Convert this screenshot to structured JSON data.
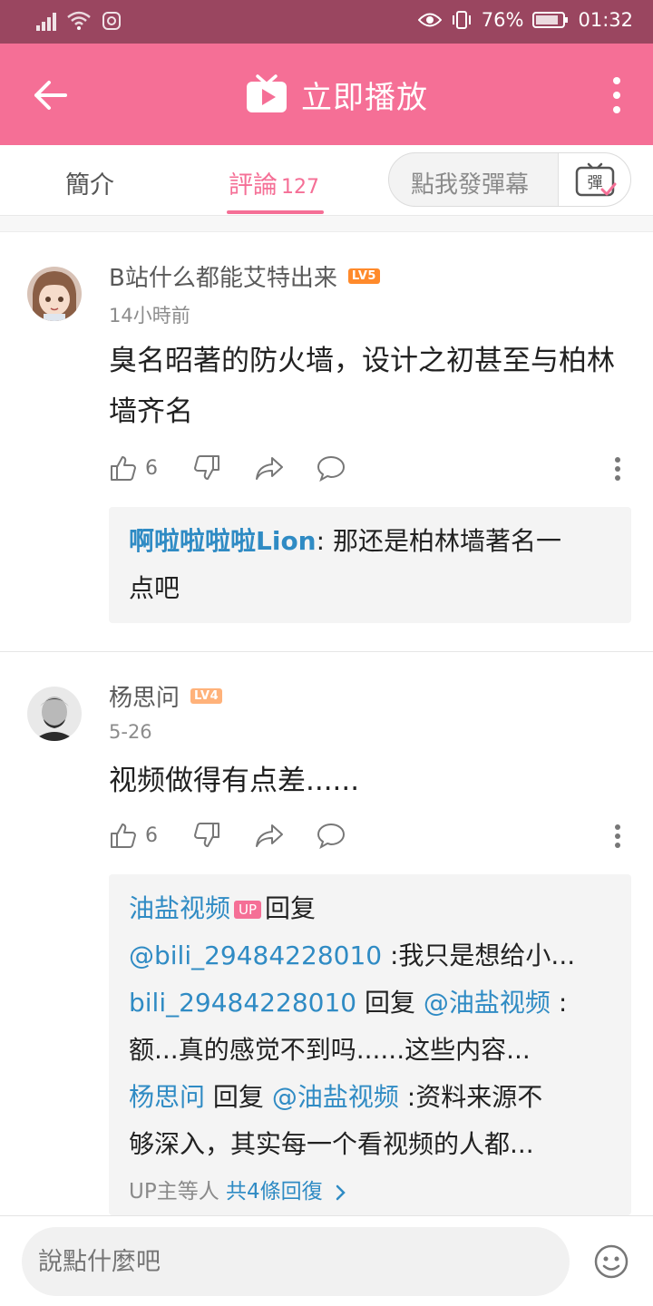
{
  "status_bar": {
    "battery": "76%",
    "time": "01:32"
  },
  "app_bar": {
    "play_label": "立即播放"
  },
  "tabs": {
    "intro": "簡介",
    "comments": "評論",
    "comments_count": "127",
    "danmaku_placeholder": "點我發彈幕",
    "danmaku_icon_text": "彈"
  },
  "comments": [
    {
      "user": "B站什么都能艾特出来",
      "level": "LV5",
      "time": "14小時前",
      "text": "臭名昭著的防火墙，设计之初甚至与柏林墙齐名",
      "likes": "6",
      "replies": [
        {
          "user": "啊啦啦啦啦Lion",
          "text": ": 那还是柏林墙著名一点吧"
        }
      ]
    },
    {
      "user": "杨思问",
      "level": "LV4",
      "time": "5-26",
      "text": "视频做得有点差......",
      "likes": "6",
      "replies": [
        {
          "user": "油盐视频",
          "badge": "UP",
          "reply_word": "回复"
        },
        {
          "mention": "@bili_29484228010",
          "text": " :我只是想给小..."
        },
        {
          "user": "bili_29484228010",
          "reply_word": "回复",
          "mention": "@油盐视频",
          "text": " :"
        },
        {
          "text": "额...真的感觉不到吗......这些内容..."
        },
        {
          "user": "杨思问",
          "reply_word": "回复",
          "mention": "@油盐视频",
          "text": " :资料来源不"
        },
        {
          "text": "够深入，其实每一个看视频的人都..."
        }
      ],
      "reply_total_prefix": "UP主等人",
      "reply_total_link": "共4條回復"
    }
  ],
  "bottom": {
    "input_placeholder": "說點什麼吧"
  }
}
